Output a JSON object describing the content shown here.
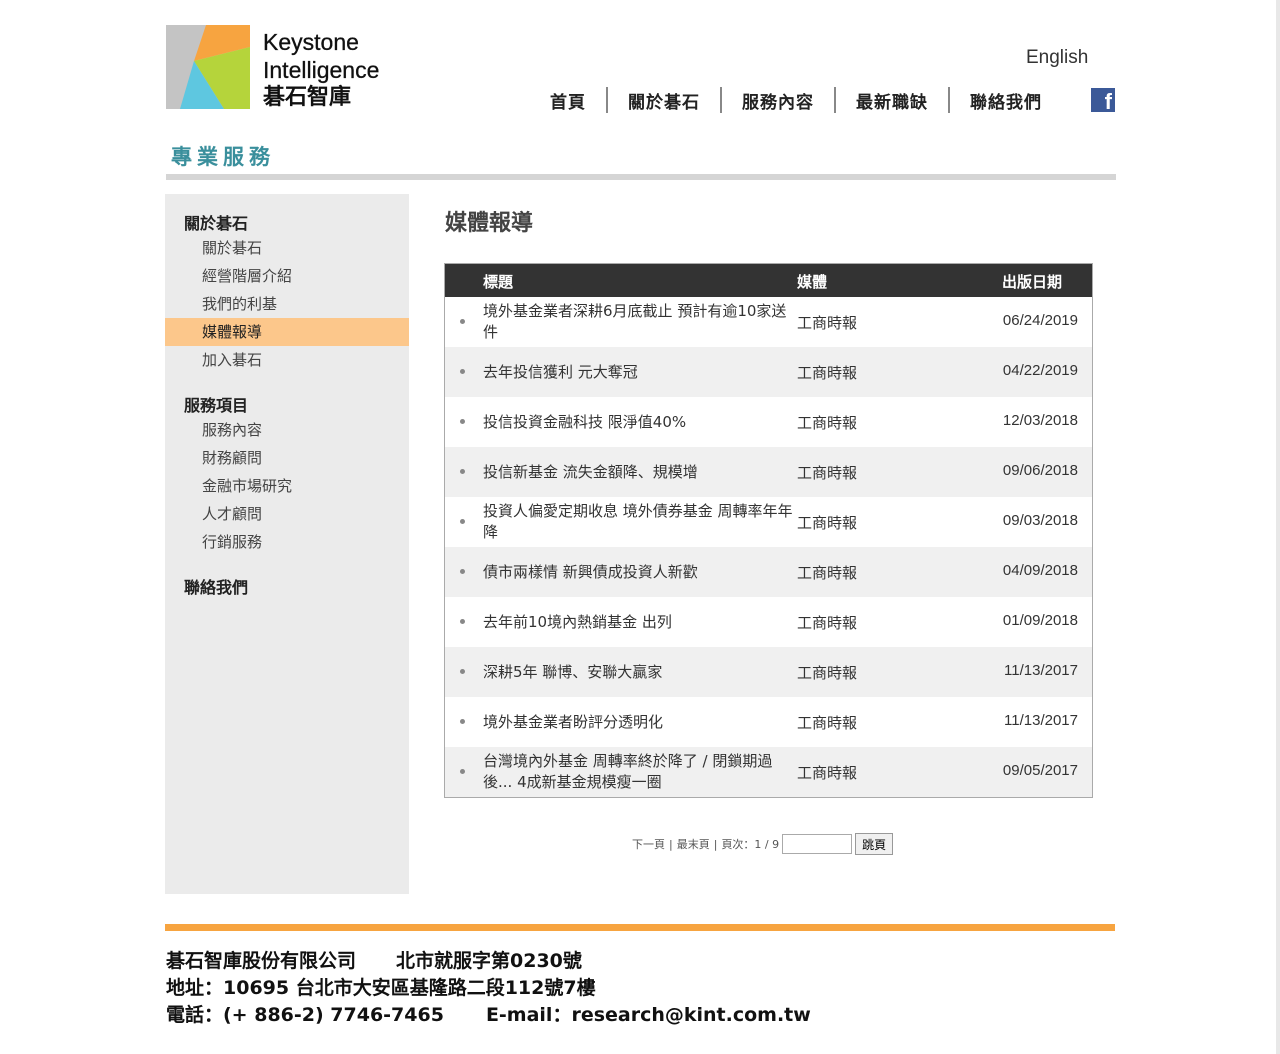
{
  "header": {
    "brand_en_1": "Keystone",
    "brand_en_2": "Intelligence",
    "brand_zh": "碁石智庫",
    "lang_link": "English",
    "nav": [
      "首頁",
      "關於碁石",
      "服務內容",
      "最新職缺",
      "聯絡我們"
    ],
    "facebook_glyph": "f"
  },
  "section_title": "專業服務",
  "sidebar": {
    "group1": "關於碁石",
    "group1_items": [
      "關於碁石",
      "經營階層介紹",
      "我們的利基",
      "媒體報導",
      "加入碁石"
    ],
    "active_item": "媒體報導",
    "group2": "服務項目",
    "group2_items": [
      "服務內容",
      "財務顧問",
      "金融市場研究",
      "人才顧問",
      "行銷服務"
    ],
    "group3": "聯絡我們"
  },
  "main": {
    "heading": "媒體報導",
    "columns": [
      "標題",
      "媒體",
      "出版日期"
    ],
    "rows": [
      {
        "title": "境外基金業者深耕6月底截止 預計有逾10家送件",
        "media": "工商時報",
        "date": "06/24/2019"
      },
      {
        "title": "去年投信獲利 元大奪冠",
        "media": "工商時報",
        "date": "04/22/2019"
      },
      {
        "title": "投信投資金融科技 限淨值40%",
        "media": "工商時報",
        "date": "12/03/2018"
      },
      {
        "title": "投信新基金 流失金額降、規模增",
        "media": "工商時報",
        "date": "09/06/2018"
      },
      {
        "title": "投資人偏愛定期收息 境外債券基金 周轉率年年降",
        "media": "工商時報",
        "date": "09/03/2018"
      },
      {
        "title": "債市兩樣情 新興債成投資人新歡",
        "media": "工商時報",
        "date": "04/09/2018"
      },
      {
        "title": "去年前10境內熱銷基金 出列",
        "media": "工商時報",
        "date": "01/09/2018"
      },
      {
        "title": "深耕5年 聯博、安聯大贏家",
        "media": "工商時報",
        "date": "11/13/2017"
      },
      {
        "title": "境外基金業者盼評分透明化",
        "media": "工商時報",
        "date": "11/13/2017"
      },
      {
        "title": "台灣境內外基金 周轉率終於降了 / 閉鎖期過後... 4成新基金規模瘦一圈",
        "media": "工商時報",
        "date": "09/05/2017"
      }
    ]
  },
  "pager": {
    "next": "下一頁",
    "sep": "|",
    "last": "最末頁",
    "page_info": "頁次：1 / 9",
    "input_value": "",
    "go_button": "跳頁"
  },
  "footer": {
    "company": "碁石智庫股份有限公司",
    "license": "北市就服字第0230號",
    "address": "地址：10695 台北市大安區基隆路二段112號7樓",
    "phone": "電話：(+ 886-2) 7746-7465",
    "email": "E-mail：research@kint.com.tw"
  },
  "colors": {
    "accent_orange": "#f7a440",
    "active_item": "#fcc78b",
    "teal": "#3a8f9c",
    "table_header": "#333333"
  }
}
